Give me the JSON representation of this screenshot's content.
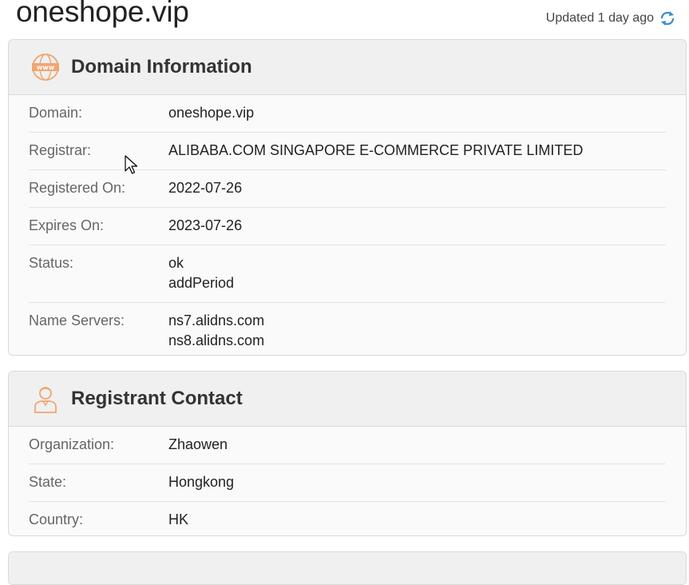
{
  "page": {
    "title": "oneshope.vip",
    "updated": "Updated 1 day ago"
  },
  "domain_info": {
    "heading": "Domain Information",
    "icon": "www-icon",
    "rows": [
      {
        "label": "Domain:",
        "values": [
          "oneshope.vip"
        ]
      },
      {
        "label": "Registrar:",
        "values": [
          "ALIBABA.COM SINGAPORE E-COMMERCE PRIVATE LIMITED"
        ]
      },
      {
        "label": "Registered On:",
        "values": [
          "2022-07-26"
        ]
      },
      {
        "label": "Expires On:",
        "values": [
          "2023-07-26"
        ]
      },
      {
        "label": "Status:",
        "values": [
          "ok",
          "addPeriod"
        ]
      },
      {
        "label": "Name Servers:",
        "values": [
          "ns7.alidns.com",
          "ns8.alidns.com"
        ]
      }
    ]
  },
  "registrant": {
    "heading": "Registrant Contact",
    "icon": "person-icon",
    "rows": [
      {
        "label": "Organization:",
        "values": [
          "Zhaowen"
        ]
      },
      {
        "label": "State:",
        "values": [
          "Hongkong"
        ]
      },
      {
        "label": "Country:",
        "values": [
          "HK"
        ]
      }
    ]
  },
  "colors": {
    "accent_orange": "#f0a572",
    "refresh_blue": "#3a8fd6"
  }
}
